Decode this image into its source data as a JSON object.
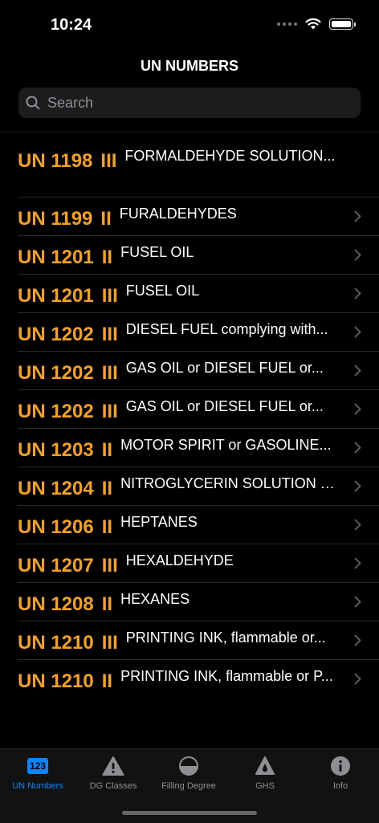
{
  "status": {
    "time": "10:24"
  },
  "nav": {
    "title": "UN NUMBERS"
  },
  "search": {
    "placeholder": "Search"
  },
  "rows": [
    {
      "un": "UN 1198",
      "pg": "III",
      "name": "FORMALDEHYDE SOLUTION..."
    },
    {
      "un": "UN 1199",
      "pg": "II",
      "name": "FURALDEHYDES"
    },
    {
      "un": "UN 1201",
      "pg": "II",
      "name": "FUSEL OIL"
    },
    {
      "un": "UN 1201",
      "pg": "III",
      "name": "FUSEL OIL"
    },
    {
      "un": "UN 1202",
      "pg": "III",
      "name": "DIESEL FUEL complying with..."
    },
    {
      "un": "UN 1202",
      "pg": "III",
      "name": "GAS OIL or DIESEL FUEL or..."
    },
    {
      "un": "UN 1202",
      "pg": "III",
      "name": "GAS OIL or DIESEL FUEL or..."
    },
    {
      "un": "UN 1203",
      "pg": "II",
      "name": "MOTOR SPIRIT or GASOLINE..."
    },
    {
      "un": "UN 1204",
      "pg": "II",
      "name": "NITROGLYCERIN SOLUTION I..."
    },
    {
      "un": "UN 1206",
      "pg": "II",
      "name": "HEPTANES"
    },
    {
      "un": "UN 1207",
      "pg": "III",
      "name": "HEXALDEHYDE"
    },
    {
      "un": "UN 1208",
      "pg": "II",
      "name": "HEXANES"
    },
    {
      "un": "UN 1210",
      "pg": "III",
      "name": "PRINTING INK, flammable or..."
    },
    {
      "un": "UN 1210",
      "pg": "II",
      "name": "PRINTING INK, flammable or P..."
    }
  ],
  "tabs": [
    {
      "label": "UN Numbers",
      "badge": "123",
      "icon": "un-numbers-icon"
    },
    {
      "label": "DG Classes",
      "icon": "warning-triangle-icon"
    },
    {
      "label": "Filling Degree",
      "icon": "half-circle-icon"
    },
    {
      "label": "GHS",
      "icon": "drop-icon"
    },
    {
      "label": "Info",
      "icon": "info-icon"
    }
  ],
  "colors": {
    "accent": "#f5a11f",
    "active_tab": "#0a84ff",
    "background": "#000000"
  }
}
